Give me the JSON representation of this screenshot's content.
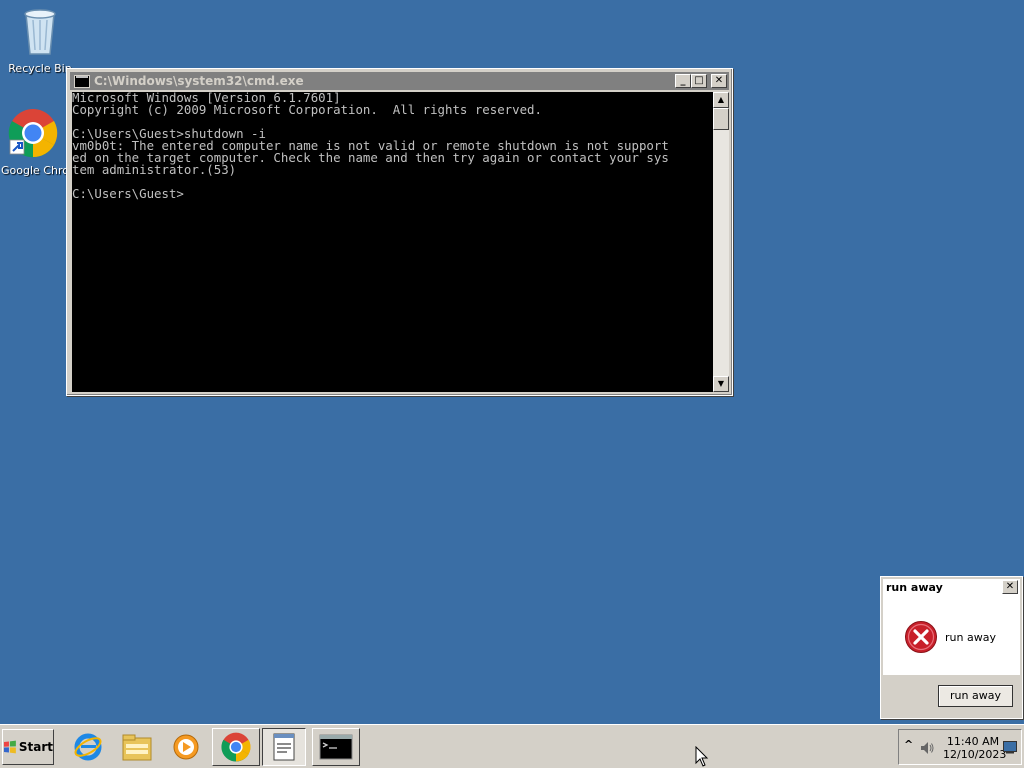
{
  "desktop": {
    "icons": [
      {
        "label": "Recycle Bin",
        "icon": "recycle-bin-icon"
      },
      {
        "label": "Google Chrome",
        "icon": "chrome-icon"
      }
    ]
  },
  "cmd_window": {
    "title": "C:\\Windows\\system32\\cmd.exe",
    "console_lines": [
      "Microsoft Windows [Version 6.1.7601]",
      "Copyright (c) 2009 Microsoft Corporation.  All rights reserved.",
      "",
      "C:\\Users\\Guest>shutdown -i",
      "vm0b0t: The entered computer name is not valid or remote shutdown is not support",
      "ed on the target computer. Check the name and then try again or contact your sys",
      "tem administrator.(53)",
      "",
      "C:\\Users\\Guest>"
    ],
    "buttons": {
      "minimize": "_",
      "maximize": "□",
      "close": "✕"
    }
  },
  "dialog": {
    "title": "run away",
    "message": "run away",
    "button_label": "run away",
    "close": "✕",
    "icon": "error-icon"
  },
  "taskbar": {
    "start_label": "Start",
    "items": [
      "internet-explorer-icon",
      "windows-explorer-icon",
      "media-player-icon",
      "chrome-icon",
      "notepad-icon",
      "cmd-icon"
    ],
    "tray": {
      "time": "11:40 AM",
      "date": "12/10/2023",
      "show_hidden": "^"
    }
  }
}
